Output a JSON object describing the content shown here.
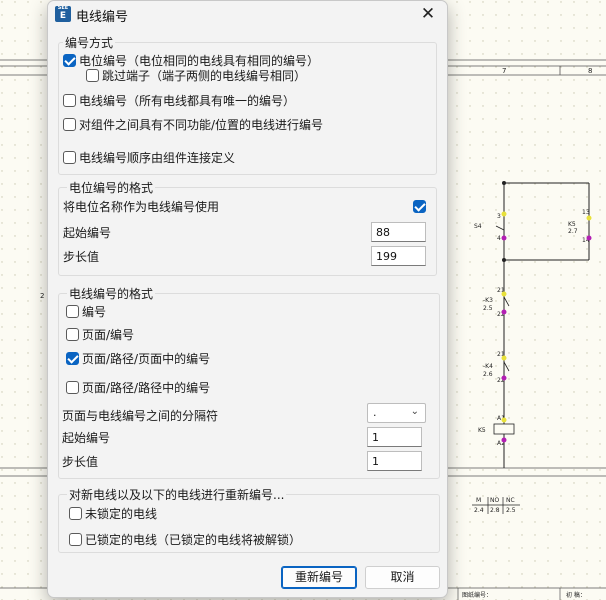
{
  "dialog": {
    "title": "电线编号",
    "icon": {
      "name": "app-icon",
      "top": "SEE",
      "bottom": "E"
    },
    "close_symbol": "✕"
  },
  "numbering_mode": {
    "title": "编号方式",
    "potential_numbering": {
      "label": "电位编号（电位相同的电线具有相同的编号）",
      "checked": true
    },
    "skip_terminals": {
      "label": "跳过端子（端子两侧的电线编号相同）",
      "checked": false
    },
    "wire_numbering": {
      "label": "电线编号（所有电线都具有唯一的编号）",
      "checked": false
    },
    "different_function": {
      "label": "对组件之间具有不同功能/位置的电线进行编号",
      "checked": false
    },
    "order_defined": {
      "label": "电线编号顺序由组件连接定义",
      "checked": false
    }
  },
  "potential_format": {
    "title": "电位编号的格式",
    "use_name_label": "将电位名称作为电线编号使用",
    "use_name_checked": true,
    "start_label": "起始编号",
    "start_value": "88",
    "step_label": "步长值",
    "step_value": "199"
  },
  "wire_format": {
    "title": "电线编号的格式",
    "options": [
      {
        "label": "编号",
        "checked": false
      },
      {
        "label": "页面/编号",
        "checked": false
      },
      {
        "label": "页面/路径/页面中的编号",
        "checked": true
      },
      {
        "label": "页面/路径/路径中的编号",
        "checked": false
      }
    ],
    "separator_label": "页面与电线编号之间的分隔符",
    "separator_value": ".",
    "start_label": "起始编号",
    "start_value": "1",
    "step_label": "步长值",
    "step_value": "1"
  },
  "renumber": {
    "title": "对新电线以及以下的电线进行重新编号...",
    "unlocked": {
      "label": "未锁定的电线",
      "checked": false
    },
    "locked": {
      "label": "已锁定的电线（已锁定的电线将被解锁）",
      "checked": false
    }
  },
  "buttons": {
    "renumber": "重新编号",
    "cancel": "取消"
  },
  "background": {
    "col7": "7",
    "col8": "8",
    "s4": "S4",
    "k5_right": "K5",
    "k5_right_sub": "2.7",
    "k5_13": "13",
    "k5_14": "14",
    "s4_3": "3",
    "s4_4": "4",
    "k3": "-K3",
    "k3_sub": "2.5",
    "k3_21": "21",
    "k3_22": "22",
    "k4": "-K4",
    "k4_sub": "2.6",
    "k4_21": "21",
    "k4_22": "22",
    "k5_coil": "K5",
    "a1": "A1",
    "a2": "A2",
    "m_col": "M",
    "no_col": "NO",
    "nc_col": "NC",
    "m_val": "2.4",
    "no_val": "2.8",
    "nc_val": "2.5",
    "drawing_no": "图纸编号：",
    "first": "初  稿：",
    "left_num": "2",
    "left_num2": "2"
  }
}
